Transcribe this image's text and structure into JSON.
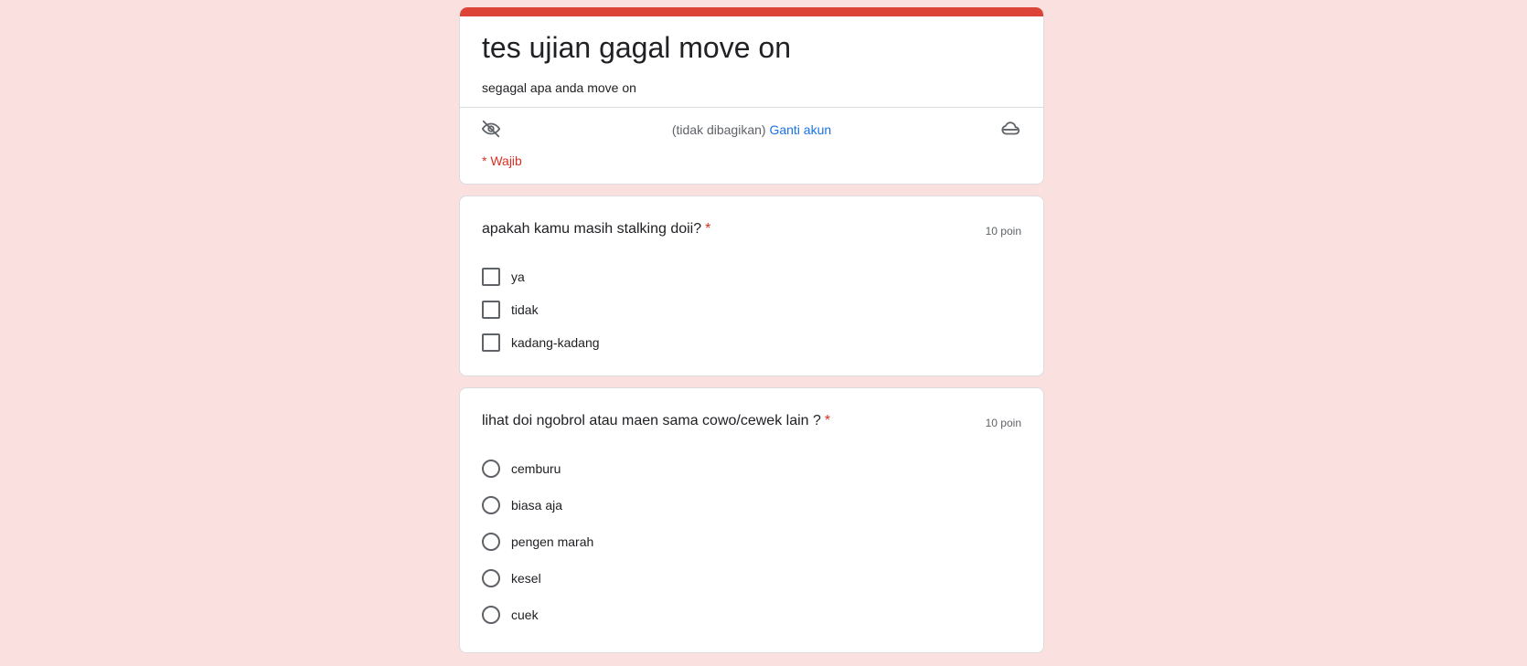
{
  "form": {
    "title": "tes ujian gagal move on",
    "description": "segagal apa anda move on",
    "account_status": "(tidak dibagikan)",
    "switch_account": "Ganti akun",
    "required_note": "* Wajib",
    "accent_color": "#db4437",
    "background_color": "#fae0de",
    "icons": {
      "privacy": "eye-off-icon",
      "sync": "cloud-icon"
    }
  },
  "questions": [
    {
      "title": "apakah kamu masih stalking doii?",
      "required_mark": "*",
      "points": "10 poin",
      "type": "checkbox",
      "options": [
        "ya",
        "tidak",
        "kadang-kadang"
      ]
    },
    {
      "title": "lihat doi ngobrol atau maen sama cowo/cewek lain ?",
      "required_mark": "*",
      "points": "10 poin",
      "type": "radio",
      "options": [
        "cemburu",
        "biasa aja",
        "pengen marah",
        "kesel",
        "cuek"
      ]
    }
  ]
}
